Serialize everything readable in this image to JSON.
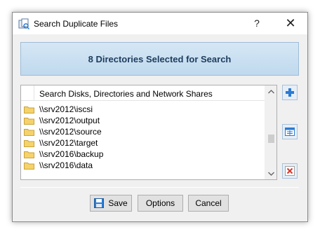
{
  "window": {
    "title": "Search Duplicate Files",
    "help_label": "?",
    "close_label": "✕"
  },
  "banner": {
    "text": "8 Directories Selected for Search"
  },
  "list": {
    "header": "Search Disks, Directories and Network Shares",
    "items": [
      {
        "label": "\\\\srv2012\\iscsi"
      },
      {
        "label": "\\\\srv2012\\output"
      },
      {
        "label": "\\\\srv2012\\source"
      },
      {
        "label": "\\\\srv2012\\target"
      },
      {
        "label": "\\\\srv2016\\backup"
      },
      {
        "label": "\\\\srv2016\\data"
      }
    ]
  },
  "buttons": {
    "save": "Save",
    "options": "Options",
    "cancel": "Cancel"
  },
  "colors": {
    "banner_text": "#1d3c5d",
    "folder": "#f5d26a",
    "accent_blue": "#2c7bd1",
    "delete_red": "#d7392d"
  },
  "icons": {
    "app": "duplicate-files-icon",
    "add": "add-icon",
    "properties": "properties-icon",
    "delete": "delete-icon",
    "save": "floppy-icon"
  }
}
